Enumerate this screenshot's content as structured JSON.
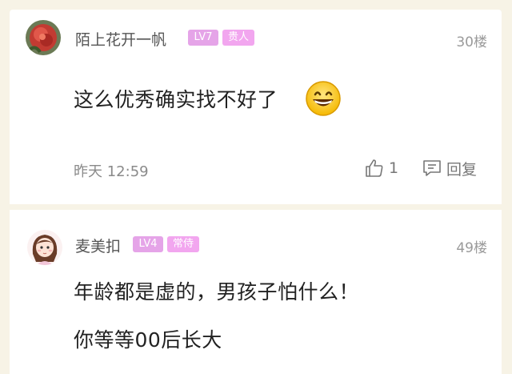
{
  "comments": [
    {
      "user": "陌上花开一帆",
      "level": "LV7",
      "title": "贵人",
      "floor": "30楼",
      "text": "这么优秀确实找不好了",
      "time": "昨天 12:59",
      "likes": "1",
      "reply_label": "回复",
      "avatar_icon": "flower-avatar-icon",
      "emoji_icon": "grinning-face-emoji-icon"
    },
    {
      "user": "麦美扣",
      "level": "LV4",
      "title": "常侍",
      "floor": "49楼",
      "lines": [
        "年龄都是虚的，男孩子怕什么！",
        "你等等00后长大"
      ],
      "avatar_icon": "cartoon-girl-avatar-icon"
    }
  ],
  "colors": {
    "background": "#f7f3e6",
    "badge_level": "#e5a4e8",
    "badge_title": "#f2a6ef",
    "username": "#555555",
    "meta": "#9a9a9a"
  }
}
